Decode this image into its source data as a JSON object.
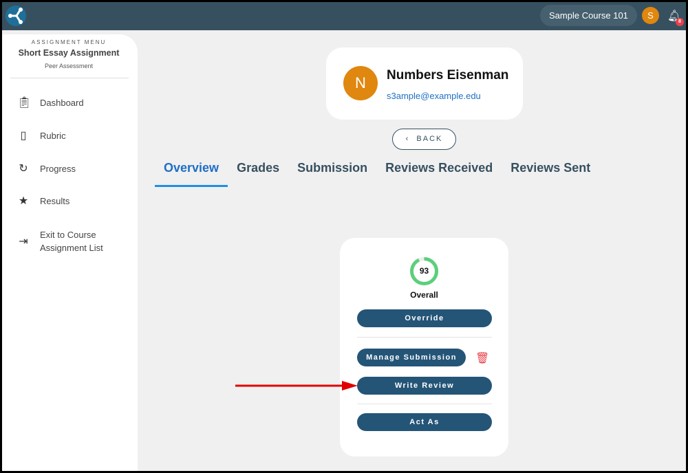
{
  "topbar": {
    "course": "Sample Course 101",
    "user_initial": "S",
    "notification_count": "8"
  },
  "sidebar": {
    "caption": "ASSIGNMENT MENU",
    "title": "Short Essay Assignment",
    "subtitle": "Peer Assessment",
    "items": [
      {
        "label": "Dashboard",
        "icon": "clipboard-icon"
      },
      {
        "label": "Rubric",
        "icon": "clipboard-outline-icon"
      },
      {
        "label": "Progress",
        "icon": "progress-icon"
      },
      {
        "label": "Results",
        "icon": "star-icon"
      },
      {
        "label": "Exit to Course Assignment List",
        "icon": "exit-icon"
      }
    ]
  },
  "profile": {
    "initial": "N",
    "name": "Numbers Eisenman",
    "email": "s3ample@example.edu"
  },
  "back_label": "BACK",
  "tabs": [
    "Overview",
    "Grades",
    "Submission",
    "Reviews Received",
    "Reviews Sent"
  ],
  "card": {
    "score": "93",
    "score_percent": 93,
    "score_label": "Overall",
    "override": "Override",
    "manage": "Manage Submission",
    "write_review": "Write Review",
    "act_as": "Act As"
  },
  "colors": {
    "topbar": "#37505f",
    "button": "#245577",
    "accent": "#1f6fc5",
    "ring": "#5ccf7a",
    "annotation": "#e00000"
  }
}
